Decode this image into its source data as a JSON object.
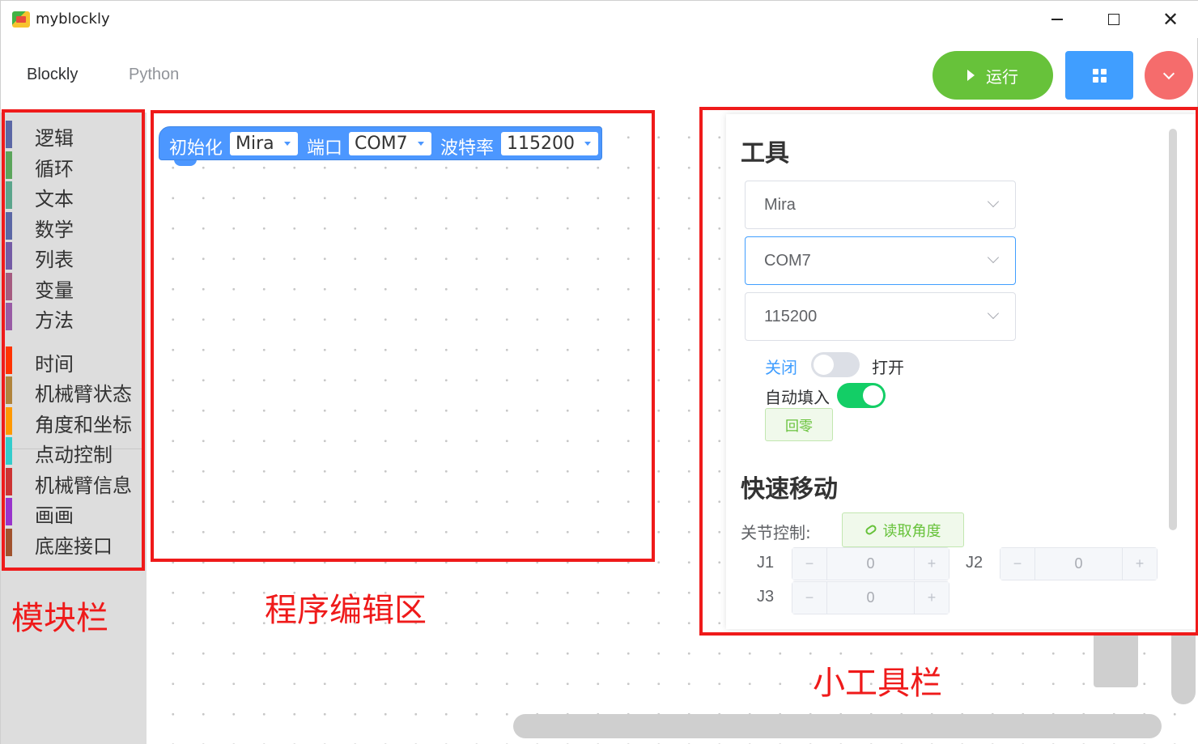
{
  "window": {
    "title": "myblockly",
    "minimize_glyph": "—",
    "maximize_glyph": "☐",
    "close_glyph": "✕"
  },
  "header": {
    "tabs": [
      {
        "label": "Blockly",
        "active": true
      },
      {
        "label": "Python",
        "active": false
      }
    ],
    "run_label": "运行",
    "colors": {
      "run": "#67c23a",
      "grid": "#409eff",
      "menu": "#f56c6c"
    }
  },
  "toolbox": {
    "categories": [
      {
        "label": "逻辑",
        "color": "#5b67a5"
      },
      {
        "label": "循环",
        "color": "#5ba55b"
      },
      {
        "label": "文本",
        "color": "#5ba58c"
      },
      {
        "label": "数学",
        "color": "#5b67a5"
      },
      {
        "label": "列表",
        "color": "#745ba5"
      },
      {
        "label": "变量",
        "color": "#a55b80"
      },
      {
        "label": "方法",
        "color": "#995ba5"
      },
      {
        "label": "时间",
        "color": "#ff3300"
      },
      {
        "label": "机械臂状态",
        "color": "#b0843c"
      },
      {
        "label": "角度和坐标",
        "color": "#ff9900"
      },
      {
        "label": "点动控制",
        "color": "#33cccc"
      },
      {
        "label": "机械臂信息",
        "color": "#cc3333"
      },
      {
        "label": "画画",
        "color": "#9933cc"
      },
      {
        "label": "底座接口",
        "color": "#a0522d"
      }
    ]
  },
  "block": {
    "init_label": "初始化",
    "robot_value": "Mira",
    "port_label": "端口",
    "port_value": "COM7",
    "baud_label": "波特率",
    "baud_value": "115200"
  },
  "tools": {
    "heading": "工具",
    "robot_select": "Mira",
    "port_select": "COM7",
    "baud_select": "115200",
    "switch_off_label": "关闭",
    "switch_on_label": "打开",
    "power_on": false,
    "auto_fill_label": "自动填入",
    "auto_fill_on": true,
    "zero_button": "回零",
    "quick_move_heading": "快速移动",
    "joint_control_label": "关节控制:",
    "read_angle_button": "读取角度",
    "joints": [
      {
        "label": "J1",
        "value": "0"
      },
      {
        "label": "J2",
        "value": "0"
      },
      {
        "label": "J3",
        "value": "0"
      }
    ],
    "minus_glyph": "−",
    "plus_glyph": "+"
  },
  "annotations": {
    "toolbox_label": "模块栏",
    "editor_label": "程序编辑区",
    "tools_label": "小工具栏",
    "color": "#ef1a1a"
  }
}
